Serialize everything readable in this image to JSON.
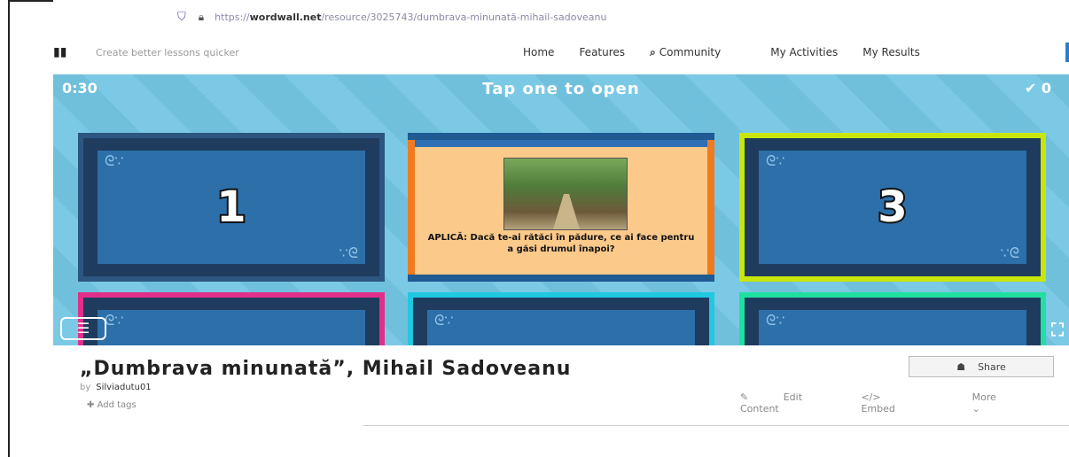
{
  "browser": {
    "url_prefix": "https://",
    "url_host": "wordwall.net",
    "url_path": "/resource/3025743/dumbrava-minunată-mihail-sadoveanu"
  },
  "nav": {
    "tagline": "Create better lessons quicker",
    "links": [
      "Home",
      "Features",
      "Community",
      "My Activities",
      "My Results"
    ]
  },
  "game": {
    "timer": "0:30",
    "instruction": "Tap one to open",
    "score_icon": "checkmark-icon",
    "score": "0",
    "cards": [
      "1",
      "3"
    ],
    "open_card_text": "APLICĂ: Dacă te-ai rătăci în pădure, ce ai face pentru a găsi drumul înapoi?",
    "colors": {
      "background": "#73c6e3",
      "card": "#1f3c5e",
      "open_card": "#fbc98a"
    }
  },
  "activity": {
    "title": "„Dumbrava minunată”, Mihail Sadoveanu",
    "by_label": "by",
    "author": "Silviadutu01",
    "add_tags": "Add tags",
    "share": "Share",
    "edit": "Edit Content",
    "embed": "Embed",
    "more": "More"
  }
}
